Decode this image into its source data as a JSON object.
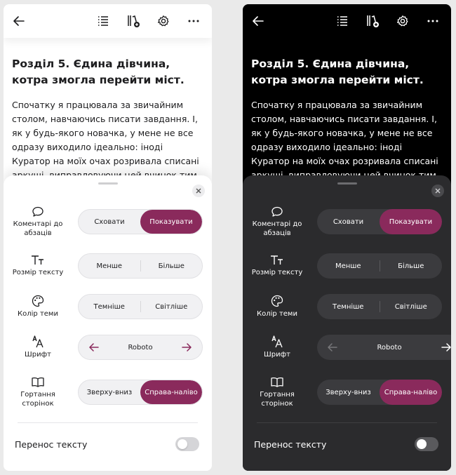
{
  "accent_color": "#8a2a5c",
  "chapter_title": "Розділ 5. Єдина дівчина, котра змогла перейти міст.",
  "body_text": "Спочатку я працювала за звичайним столом, навчаючись писати завдання. І, як у будь-якого новачка, у мене не все одразу виходило ідеально: іноді Куратор на моїх очах розривала списані аркуші, виправловуючи цей вчинок тим, що я",
  "toolbar": {
    "back_icon": "arrow-left-icon",
    "contents_icon": "list-icon",
    "bookmark_icon": "book-add-icon",
    "settings_icon": "gear-icon",
    "more_icon": "more-horizontal-icon"
  },
  "settings": {
    "comments": {
      "label": "Коментарі до абзаців",
      "icon": "speech-bubble-icon",
      "hide": "Сховати",
      "show": "Показувати",
      "active": "show"
    },
    "text_size": {
      "label": "Розмір тексту",
      "icon": "text-size-icon",
      "smaller": "Менше",
      "bigger": "Більше"
    },
    "theme_color": {
      "label": "Колір теми",
      "icon": "palette-icon",
      "darker": "Темніше",
      "lighter": "Світліше"
    },
    "font": {
      "label": "Шрифт",
      "icon": "font-icon",
      "value": "Roboto",
      "prev_icon": "arrow-left-icon",
      "next_icon": "arrow-right-icon"
    },
    "paging": {
      "label": "Гортання сторінок",
      "icon": "book-open-icon",
      "vertical": "Зверху-вниз",
      "horizontal": "Справа-наліво",
      "active": "horizontal"
    },
    "text_wrap": {
      "label": "Перенос тексту",
      "enabled": false
    }
  }
}
